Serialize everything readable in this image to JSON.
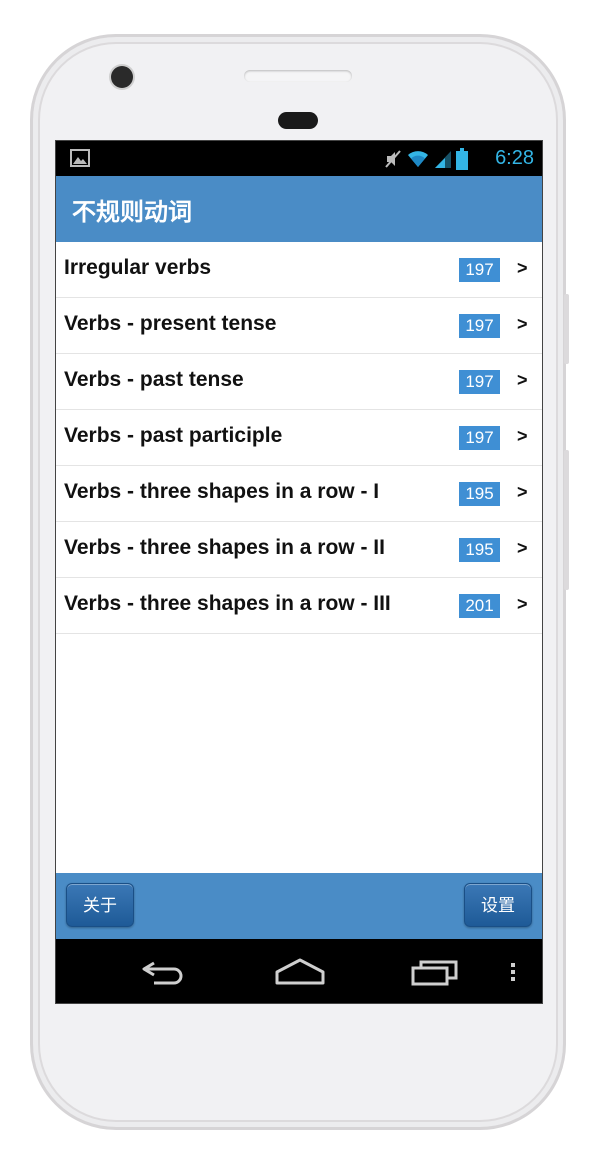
{
  "app": {
    "title": "不规则动词"
  },
  "status_bar": {
    "time": "6:28",
    "icons": [
      "gallery-notification-icon",
      "mute-icon",
      "wifi-icon",
      "signal-icon",
      "battery-icon"
    ],
    "time_color": "#33b5e5"
  },
  "list": {
    "items": [
      {
        "label": "Irregular verbs",
        "count": "197",
        "chevron": ">"
      },
      {
        "label": "Verbs - present tense",
        "count": "197",
        "chevron": ">"
      },
      {
        "label": "Verbs - past tense",
        "count": "197",
        "chevron": ">"
      },
      {
        "label": "Verbs - past participle",
        "count": "197",
        "chevron": ">"
      },
      {
        "label": "Verbs - three shapes in a row - I",
        "count": "195",
        "chevron": ">"
      },
      {
        "label": "Verbs - three shapes in a row - II",
        "count": "195",
        "chevron": ">"
      },
      {
        "label": "Verbs - three shapes in a row - III",
        "count": "201",
        "chevron": ">"
      }
    ]
  },
  "footer": {
    "about_label": "关于",
    "settings_label": "设置"
  },
  "nav_bar": {
    "icons": [
      "back-icon",
      "home-icon",
      "recent-apps-icon",
      "menu-icon"
    ]
  },
  "colors": {
    "accent": "#4a8cc6",
    "badge": "#3f8fd4"
  }
}
